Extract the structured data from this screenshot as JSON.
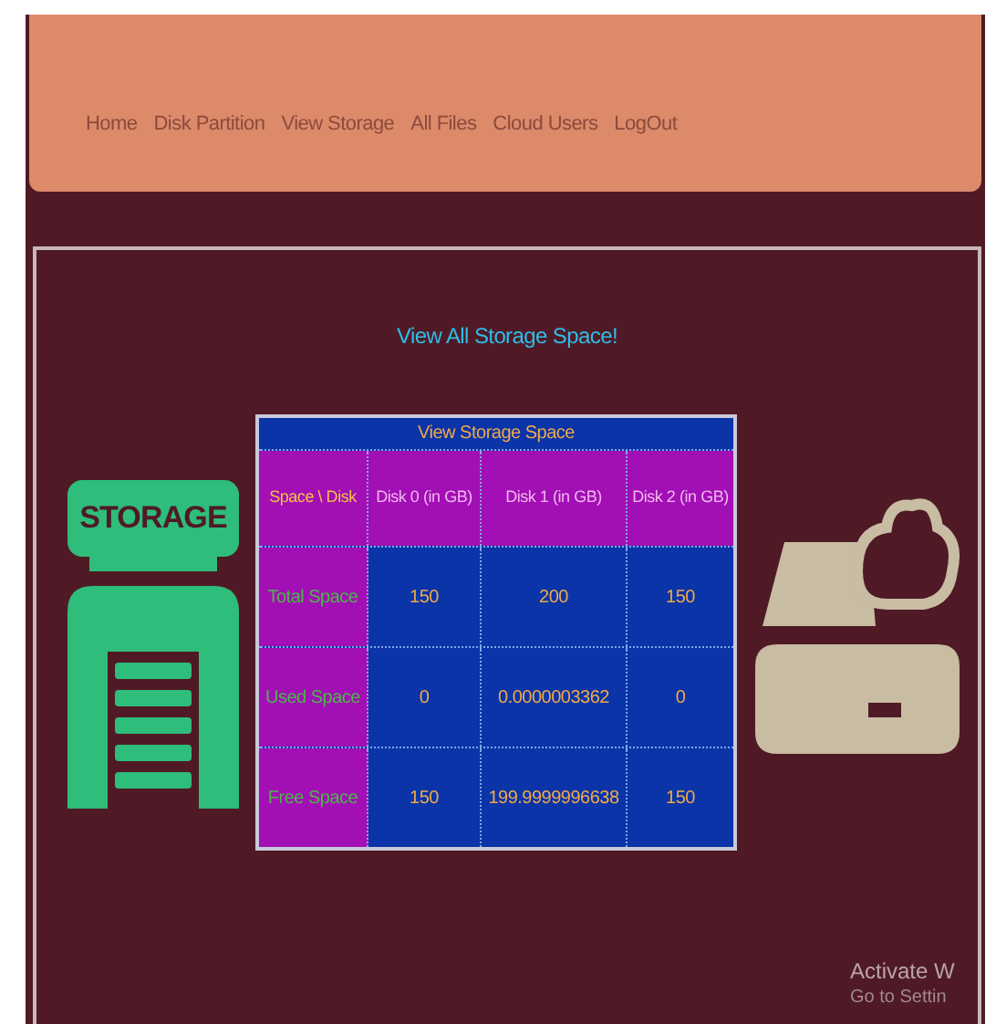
{
  "nav": {
    "items": [
      {
        "label": "Home"
      },
      {
        "label": "Disk Partition"
      },
      {
        "label": "View Storage"
      },
      {
        "label": "All Files"
      },
      {
        "label": "Cloud Users"
      },
      {
        "label": "LogOut"
      }
    ]
  },
  "heading": "View All Storage Space!",
  "table": {
    "caption": "View Storage Space",
    "columns": [
      "Space \\ Disk",
      "Disk 0 (in GB)",
      "Disk 1 (in GB)",
      "Disk 2 (in GB)"
    ],
    "rows": [
      {
        "cells": [
          "Total Space",
          "150",
          "200",
          "150"
        ]
      },
      {
        "cells": [
          "Used Space",
          "0",
          "0.0000003362",
          "0"
        ]
      },
      {
        "cells": [
          "Free Space",
          "150",
          "199.9999996638",
          "150"
        ]
      }
    ]
  },
  "storage_sign": "STORAGE",
  "activation_notice": {
    "title": "Activate W",
    "subtitle": "Go to Settin"
  }
}
